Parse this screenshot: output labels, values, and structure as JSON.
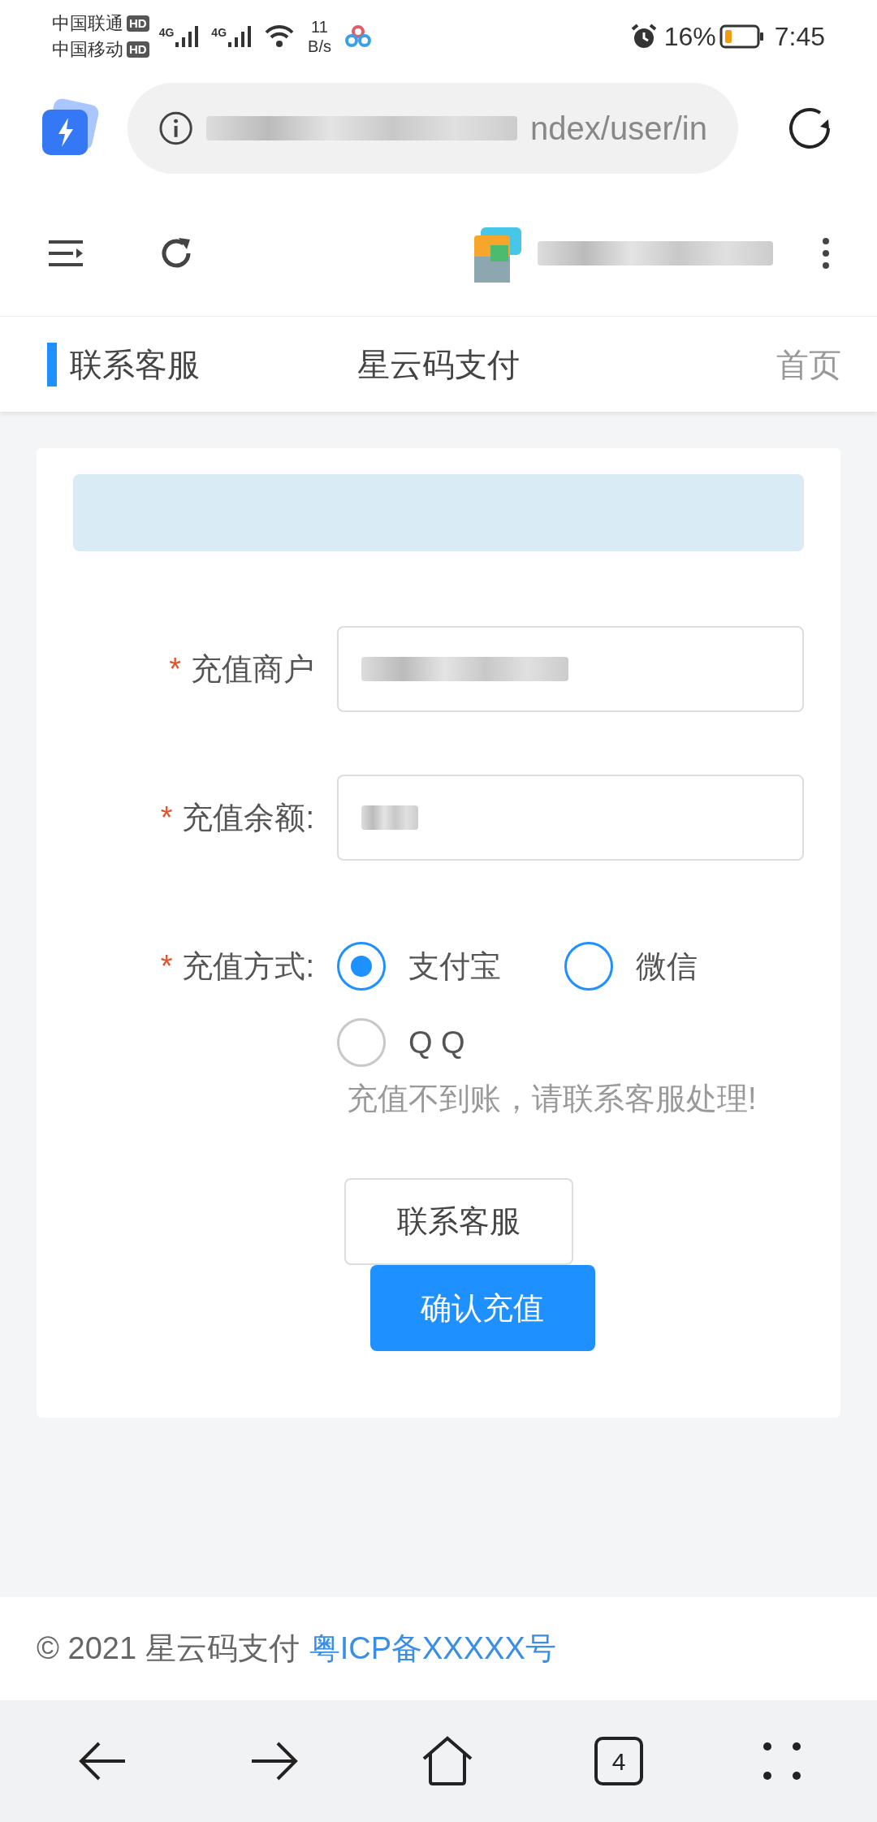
{
  "status_bar": {
    "carriers": [
      {
        "name": "中国联通",
        "badge": "HD"
      },
      {
        "name": "中国移动",
        "badge": "HD"
      }
    ],
    "networks": [
      "4G",
      "4G"
    ],
    "speed": [
      "11",
      "B/s"
    ],
    "battery": "16%",
    "time": "7:45"
  },
  "browser": {
    "url": "ndex/user/in"
  },
  "header": {
    "left": "联系客服",
    "title": "星云码支付",
    "right": "首页"
  },
  "form": {
    "fields": [
      {
        "label": "充值商户",
        "required_mark": "*"
      },
      {
        "label": "充值余额:",
        "required_mark": "*"
      }
    ],
    "payment": {
      "label": "充值方式:",
      "required_mark": "*",
      "options": [
        {
          "label": "支付宝",
          "selected": true,
          "color": "#1e90ff"
        },
        {
          "label": "微信",
          "selected": false,
          "color": "#1e90ff"
        },
        {
          "label": "Q Q",
          "selected": false,
          "color": "#c8c8c8"
        }
      ]
    },
    "hint": "充值不到账，请联系客服处理!",
    "buttons": [
      {
        "label": "联系客服",
        "kind": "outline"
      },
      {
        "label": "确认充值",
        "kind": "primary"
      }
    ]
  },
  "footer": {
    "copyright": "© 2021 星云码支付",
    "icp": "粤ICP备XXXXX号"
  },
  "bottom_nav": {
    "tab_count": "4"
  }
}
